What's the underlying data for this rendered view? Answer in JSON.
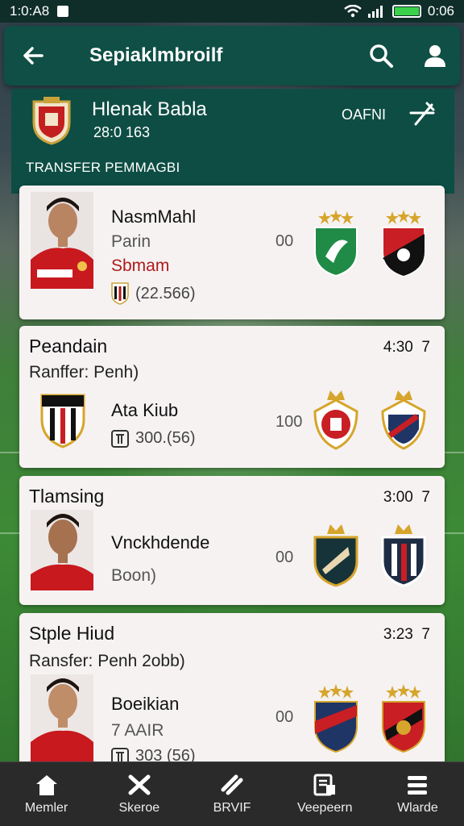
{
  "status": {
    "time": "1:0:A8",
    "battery": "0:06"
  },
  "appbar": {
    "title": "Sepiaklmbroilf"
  },
  "header": {
    "club_name": "Hlenak Babla",
    "club_sub": "28:0 163",
    "tag": "OAFNI",
    "section_label": "TRANSFER PEMMAGBI"
  },
  "cards": [
    {
      "name": "NasmMahl",
      "position": "Parin",
      "red_label": "Sbmam",
      "fee": "(22.566)",
      "score": "00"
    },
    {
      "title": "Peandain",
      "subtitle": "Ranffer: Penh)",
      "time": "4:30",
      "time_suffix": "7",
      "name": "Ata Kiub",
      "fee": "300.(56)",
      "score": "100"
    },
    {
      "title": "Tlamsing",
      "time": "3:00",
      "time_suffix": "7",
      "name": "Vnckhdende",
      "position": "Boon)",
      "score": "00"
    },
    {
      "title": "Stple Hiud",
      "subtitle": "Ransfer: Penh 2obb)",
      "time": "3:23",
      "time_suffix": "7",
      "name": "Boeikian",
      "position": "7 AAIR",
      "fee": "303 (56)",
      "score": "00"
    }
  ],
  "nav": [
    {
      "label": "Memler",
      "icon": "home-icon"
    },
    {
      "label": "Skeroe",
      "icon": "swap-icon"
    },
    {
      "label": "BRVIF",
      "icon": "transfer-icon"
    },
    {
      "label": "Veepeern",
      "icon": "document-icon"
    },
    {
      "label": "Wlarde",
      "icon": "menu-icon"
    }
  ],
  "colors": {
    "header": "#0e4d44",
    "appbar": "#0f4f45",
    "accent_red": "#b01a1a"
  }
}
